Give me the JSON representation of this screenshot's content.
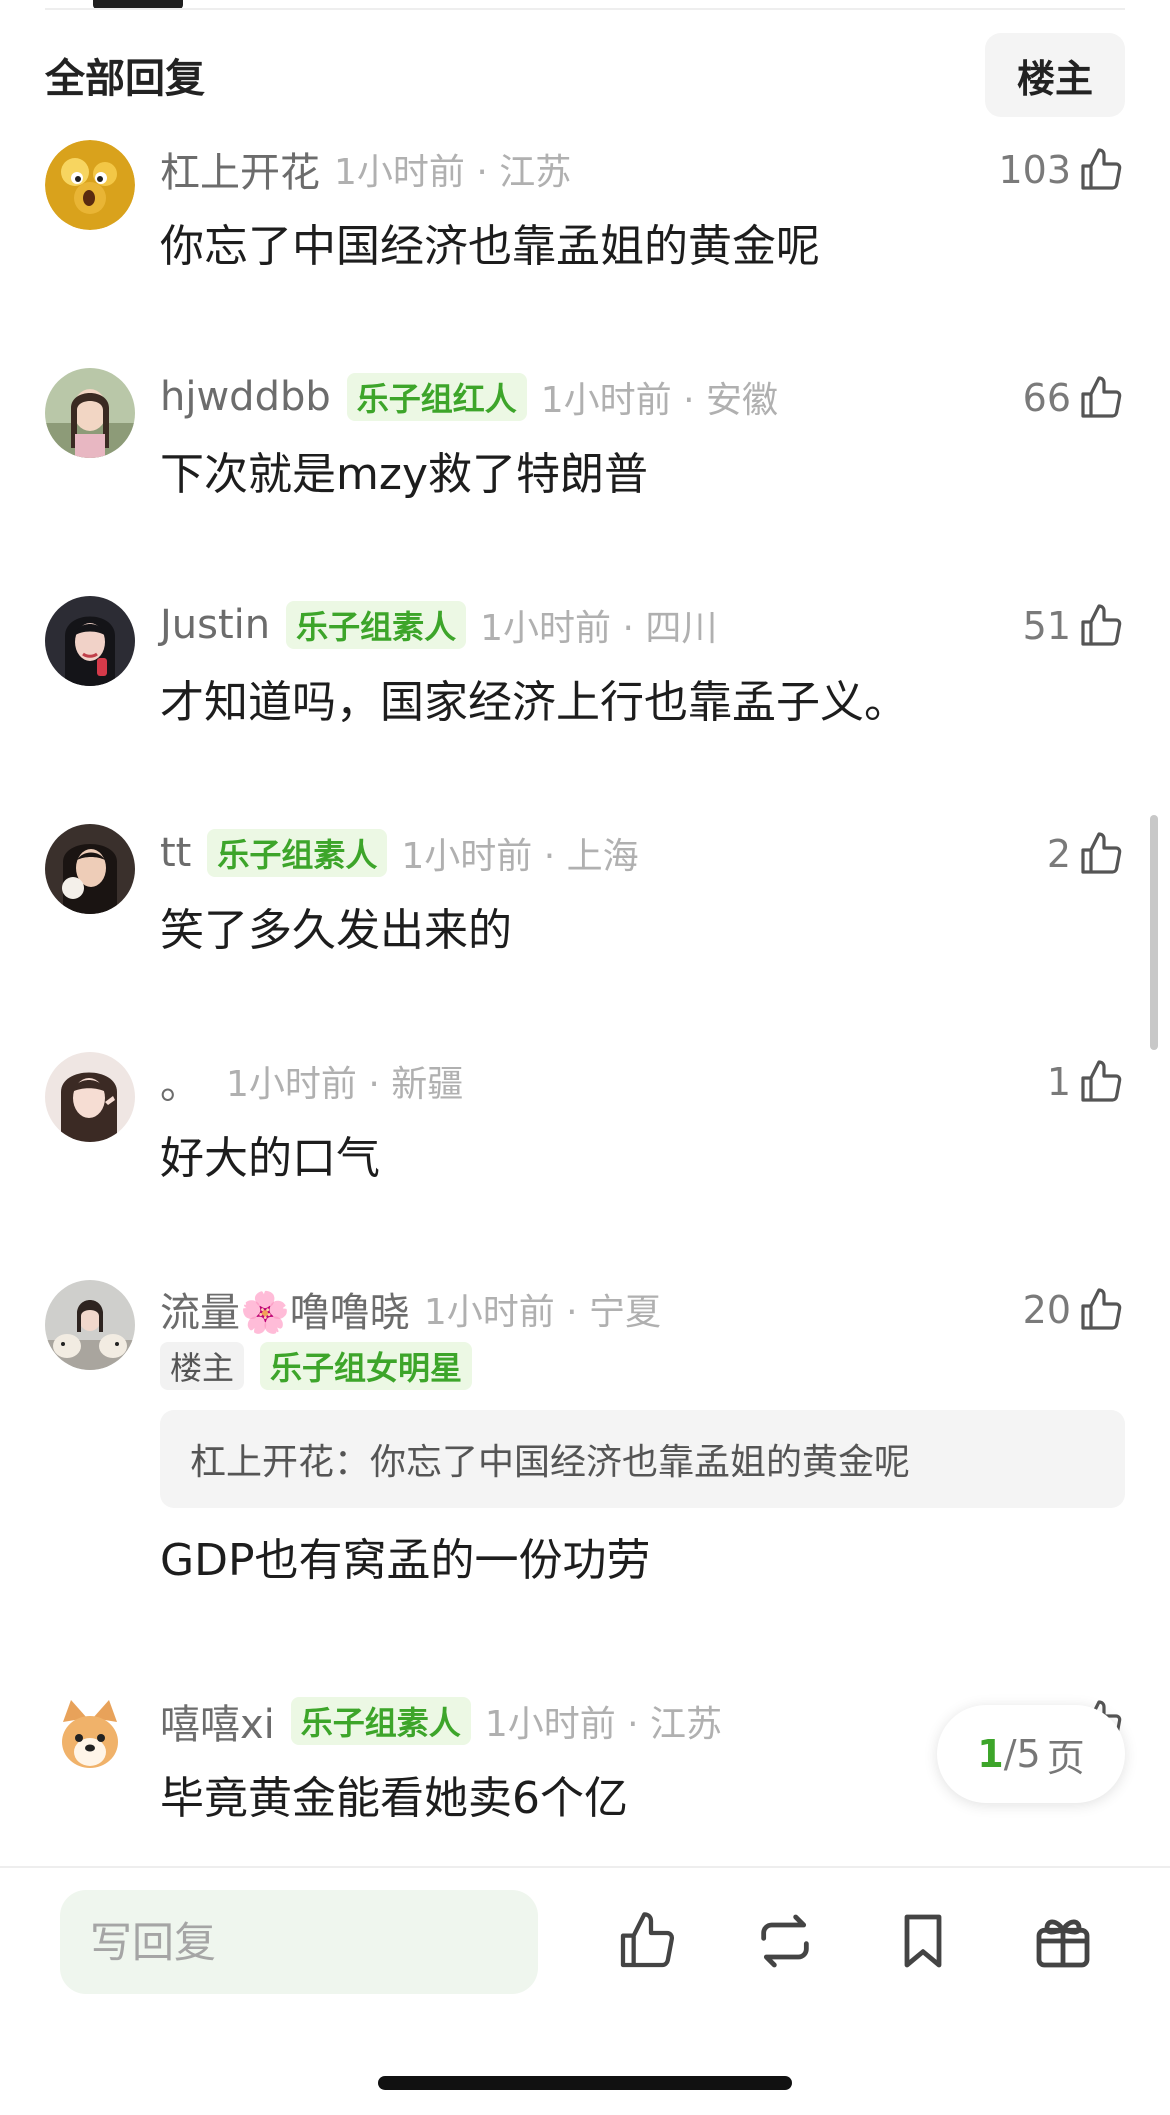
{
  "header": {
    "title": "全部回复",
    "owner_filter_label": "楼主"
  },
  "comments": [
    {
      "username": "杠上开花",
      "badges": [],
      "time": "1小时前 · 江苏",
      "likes": "103",
      "text": "你忘了中国经济也靠孟姐的黄金呢",
      "avatar": "yellow-face-avatar"
    },
    {
      "username": "hjwddbb",
      "badges": [
        "乐子组红人"
      ],
      "time": "1小时前 · 安徽",
      "likes": "66",
      "text": "下次就是mzy救了特朗普",
      "avatar": "portrait-avatar"
    },
    {
      "username": "Justin",
      "badges": [
        "乐子组素人"
      ],
      "time": "1小时前 · 四川",
      "likes": "51",
      "text": "才知道吗，国家经济上行也靠孟子义。",
      "avatar": "portrait-avatar"
    },
    {
      "username": "tt",
      "badges": [
        "乐子组素人"
      ],
      "time": "1小时前 · 上海",
      "likes": "2",
      "text": "笑了多久发出来的",
      "avatar": "portrait-avatar"
    },
    {
      "username": "。",
      "badges": [],
      "time": "1小时前 · 新疆",
      "likes": "1",
      "text": "好大的口气",
      "avatar": "portrait-avatar"
    },
    {
      "username": "流量🌸噜噜晓",
      "badges": [
        "楼主",
        "乐子组女明星"
      ],
      "time": "1小时前 · 宁夏",
      "likes": "20",
      "quote": "杠上开花：你忘了中国经济也靠孟姐的黄金呢",
      "text": "GDP也有窝孟的一份功劳",
      "avatar": "dogs-avatar"
    },
    {
      "username": "嘻嘻xi",
      "badges": [
        "乐子组素人"
      ],
      "time": "1小时前 · 江苏",
      "likes": "",
      "text": "毕竟黄金能看她卖6个亿",
      "avatar": "dog-cartoon-avatar"
    }
  ],
  "pagination": {
    "current": "1",
    "total": "/5",
    "unit": "页"
  },
  "bottom_bar": {
    "reply_placeholder": "写回复",
    "icons": [
      "thumb-up-icon",
      "repost-icon",
      "bookmark-icon",
      "gift-icon"
    ]
  },
  "colors": {
    "accent_green": "#3da52a",
    "badge_bg": "#ecf8e4",
    "input_bg": "#eff6ee",
    "meta_grey": "#b0b0b0"
  }
}
